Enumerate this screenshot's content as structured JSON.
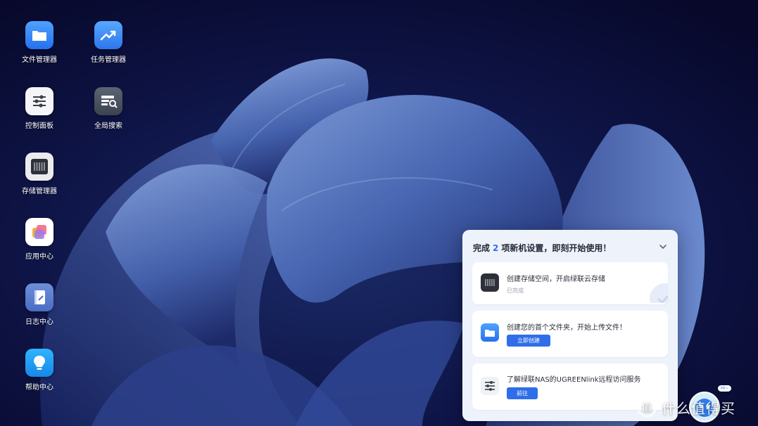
{
  "desktop": {
    "icons": [
      {
        "label": "文件管理器",
        "icon": "folder-icon"
      },
      {
        "label": "任务管理器",
        "icon": "trend-chart-icon"
      },
      {
        "label": "控制面板",
        "icon": "sliders-icon"
      },
      {
        "label": "全局搜索",
        "icon": "search-panel-icon"
      },
      {
        "label": "存储管理器",
        "icon": "storage-drive-icon"
      },
      {
        "label": "应用中心",
        "icon": "app-stack-icon"
      },
      {
        "label": "日志中心",
        "icon": "log-book-icon"
      },
      {
        "label": "帮助中心",
        "icon": "lightbulb-icon"
      }
    ]
  },
  "setup_panel": {
    "title_prefix": "完成",
    "count": "2",
    "title_suffix": "项新机设置，即刻开始使用！",
    "tasks": [
      {
        "title": "创建存储空间，开启绿联云存储",
        "status": "已完成",
        "icon": "storage-drive-icon"
      },
      {
        "title": "创建您的首个文件夹，开始上传文件！",
        "button": "立即创建",
        "icon": "folder-icon"
      },
      {
        "title": "了解绿联NAS的UGREENlink远程访问服务",
        "button": "前往",
        "icon": "sliders-icon"
      }
    ]
  },
  "assistant": {
    "bubble": "Hi~",
    "icon": "assistant-icon"
  },
  "watermark": {
    "text": "什么值得买",
    "icon": "zhi-logo-icon"
  },
  "colors": {
    "accent": "#2f6ee8",
    "background": "#0a0b2c",
    "panel": "#eef3fb"
  }
}
